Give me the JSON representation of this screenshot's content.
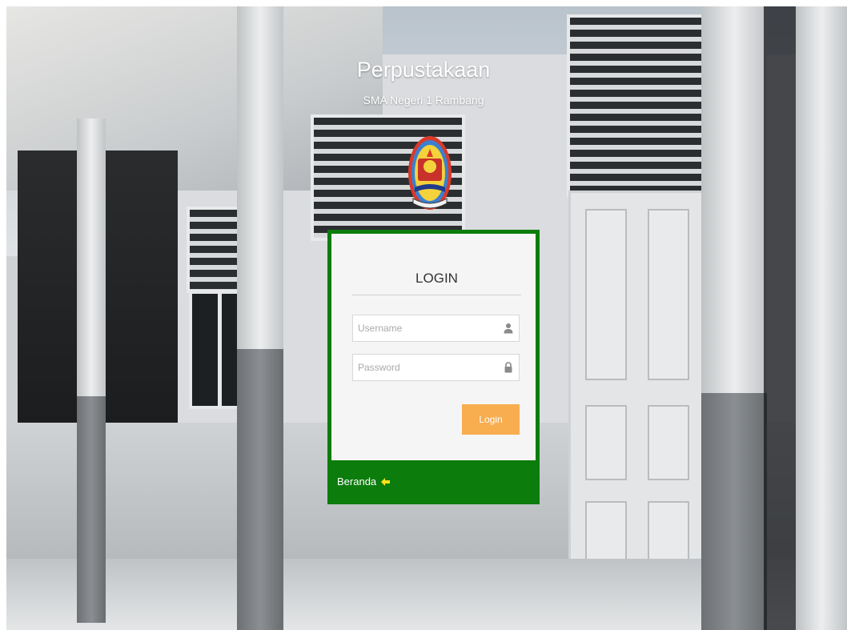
{
  "header": {
    "title": "Perpustakaan",
    "subtitle": "SMA Negeri 1 Rambang"
  },
  "logo": {
    "icon": "school-emblem-icon"
  },
  "login": {
    "heading": "LOGIN",
    "username_placeholder": "Username",
    "username_value": "",
    "username_icon": "user-icon",
    "password_placeholder": "Password",
    "password_value": "",
    "password_icon": "lock-icon",
    "button_label": "Login"
  },
  "footer_link": {
    "label": "Beranda",
    "icon": "arrow-left-icon"
  },
  "colors": {
    "card_border": "#0c7c0c",
    "card_body": "#f5f5f5",
    "button": "#f8ad4f",
    "text_light": "#ffffff"
  }
}
